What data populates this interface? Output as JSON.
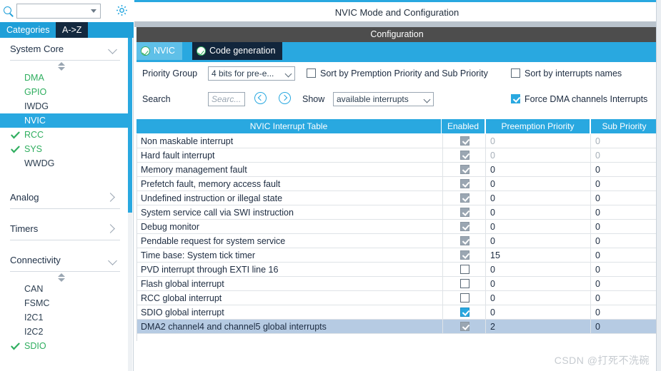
{
  "left_panel": {
    "search": {
      "placeholder": "",
      "value": "",
      "icon": "search-icon"
    },
    "settings_icon": "gear-icon",
    "tabs": [
      {
        "label": "Categories",
        "selected": false
      },
      {
        "label": "A->Z",
        "selected": true
      }
    ],
    "groups": [
      {
        "name": "System Core",
        "expanded": true,
        "items": [
          {
            "label": "DMA",
            "state": "configured",
            "checked": false,
            "selected": false
          },
          {
            "label": "GPIO",
            "state": "configured",
            "checked": false,
            "selected": false
          },
          {
            "label": "IWDG",
            "state": "default",
            "checked": false,
            "selected": false
          },
          {
            "label": "NVIC",
            "state": "default",
            "checked": false,
            "selected": true
          },
          {
            "label": "RCC",
            "state": "configured",
            "checked": true,
            "selected": false
          },
          {
            "label": "SYS",
            "state": "configured",
            "checked": true,
            "selected": false
          },
          {
            "label": "WWDG",
            "state": "default",
            "checked": false,
            "selected": false
          }
        ]
      },
      {
        "name": "Analog",
        "expanded": false,
        "items": []
      },
      {
        "name": "Timers",
        "expanded": false,
        "items": []
      },
      {
        "name": "Connectivity",
        "expanded": true,
        "items": [
          {
            "label": "CAN",
            "state": "default",
            "checked": false,
            "selected": false
          },
          {
            "label": "FSMC",
            "state": "default",
            "checked": false,
            "selected": false
          },
          {
            "label": "I2C1",
            "state": "default",
            "checked": false,
            "selected": false
          },
          {
            "label": "I2C2",
            "state": "default",
            "checked": false,
            "selected": false
          },
          {
            "label": "SDIO",
            "state": "configured",
            "checked": true,
            "selected": false
          }
        ]
      }
    ]
  },
  "right_panel": {
    "mode_title": "NVIC Mode and Configuration",
    "configuration_band": "Configuration",
    "tabs": [
      {
        "label": "NVIC",
        "active": true,
        "icon": "check-circle-icon"
      },
      {
        "label": "Code generation",
        "active": false,
        "icon": "check-circle-icon"
      }
    ],
    "options": {
      "priority_group_label": "Priority Group",
      "priority_group_value": "4 bits for pre-e...",
      "sort_by_premption_label": "Sort by Premption Priority and Sub Priority",
      "sort_by_premption_checked": false,
      "sort_by_names_label": "Sort by interrupts names",
      "sort_by_names_checked": false,
      "search_label": "Search",
      "search_placeholder": "Searc...",
      "search_value": "",
      "prev_icon": "chevron-left-circle-icon",
      "next_icon": "chevron-right-circle-icon",
      "show_label": "Show",
      "show_value": "available interrupts",
      "force_dma_label": "Force DMA channels Interrupts",
      "force_dma_checked": true
    },
    "table": {
      "columns": [
        "NVIC Interrupt Table",
        "Enabled",
        "Preemption Priority",
        "Sub Priority"
      ],
      "rows": [
        {
          "name": "Non maskable interrupt",
          "enabled": true,
          "enabled_state": "disabled",
          "preemption": "0",
          "sub": "0",
          "muted": true,
          "selected": false
        },
        {
          "name": "Hard fault interrupt",
          "enabled": true,
          "enabled_state": "disabled",
          "preemption": "0",
          "sub": "0",
          "muted": true,
          "selected": false
        },
        {
          "name": "Memory management fault",
          "enabled": true,
          "enabled_state": "disabled",
          "preemption": "0",
          "sub": "0",
          "muted": false,
          "selected": false
        },
        {
          "name": "Prefetch fault, memory access fault",
          "enabled": true,
          "enabled_state": "disabled",
          "preemption": "0",
          "sub": "0",
          "muted": false,
          "selected": false
        },
        {
          "name": "Undefined instruction or illegal state",
          "enabled": true,
          "enabled_state": "disabled",
          "preemption": "0",
          "sub": "0",
          "muted": false,
          "selected": false
        },
        {
          "name": "System service call via SWI instruction",
          "enabled": true,
          "enabled_state": "disabled",
          "preemption": "0",
          "sub": "0",
          "muted": false,
          "selected": false
        },
        {
          "name": "Debug monitor",
          "enabled": true,
          "enabled_state": "disabled",
          "preemption": "0",
          "sub": "0",
          "muted": false,
          "selected": false
        },
        {
          "name": "Pendable request for system service",
          "enabled": true,
          "enabled_state": "disabled",
          "preemption": "0",
          "sub": "0",
          "muted": false,
          "selected": false
        },
        {
          "name": "Time base: System tick timer",
          "enabled": true,
          "enabled_state": "disabled",
          "preemption": "15",
          "sub": "0",
          "muted": false,
          "selected": false
        },
        {
          "name": "PVD interrupt through EXTI line 16",
          "enabled": false,
          "enabled_state": "unchecked",
          "preemption": "0",
          "sub": "0",
          "muted": false,
          "selected": false
        },
        {
          "name": "Flash global interrupt",
          "enabled": false,
          "enabled_state": "unchecked",
          "preemption": "0",
          "sub": "0",
          "muted": false,
          "selected": false
        },
        {
          "name": "RCC global interrupt",
          "enabled": false,
          "enabled_state": "unchecked",
          "preemption": "0",
          "sub": "0",
          "muted": false,
          "selected": false
        },
        {
          "name": "SDIO global interrupt",
          "enabled": true,
          "enabled_state": "checked",
          "preemption": "0",
          "sub": "0",
          "muted": false,
          "selected": false
        },
        {
          "name": "DMA2 channel4 and channel5 global interrupts",
          "enabled": true,
          "enabled_state": "disabled",
          "preemption": "2",
          "sub": "0",
          "muted": false,
          "selected": true
        }
      ]
    }
  },
  "watermark": "CSDN @打死不洗碗",
  "colors": {
    "accent_blue": "#29a8e0",
    "tab_active_blue": "#5fc0e8",
    "tab_dark": "#12263c",
    "config_band_gray": "#4d4d4d",
    "row_selected": "#b6cbe3",
    "green_text": "#2fae5f"
  }
}
